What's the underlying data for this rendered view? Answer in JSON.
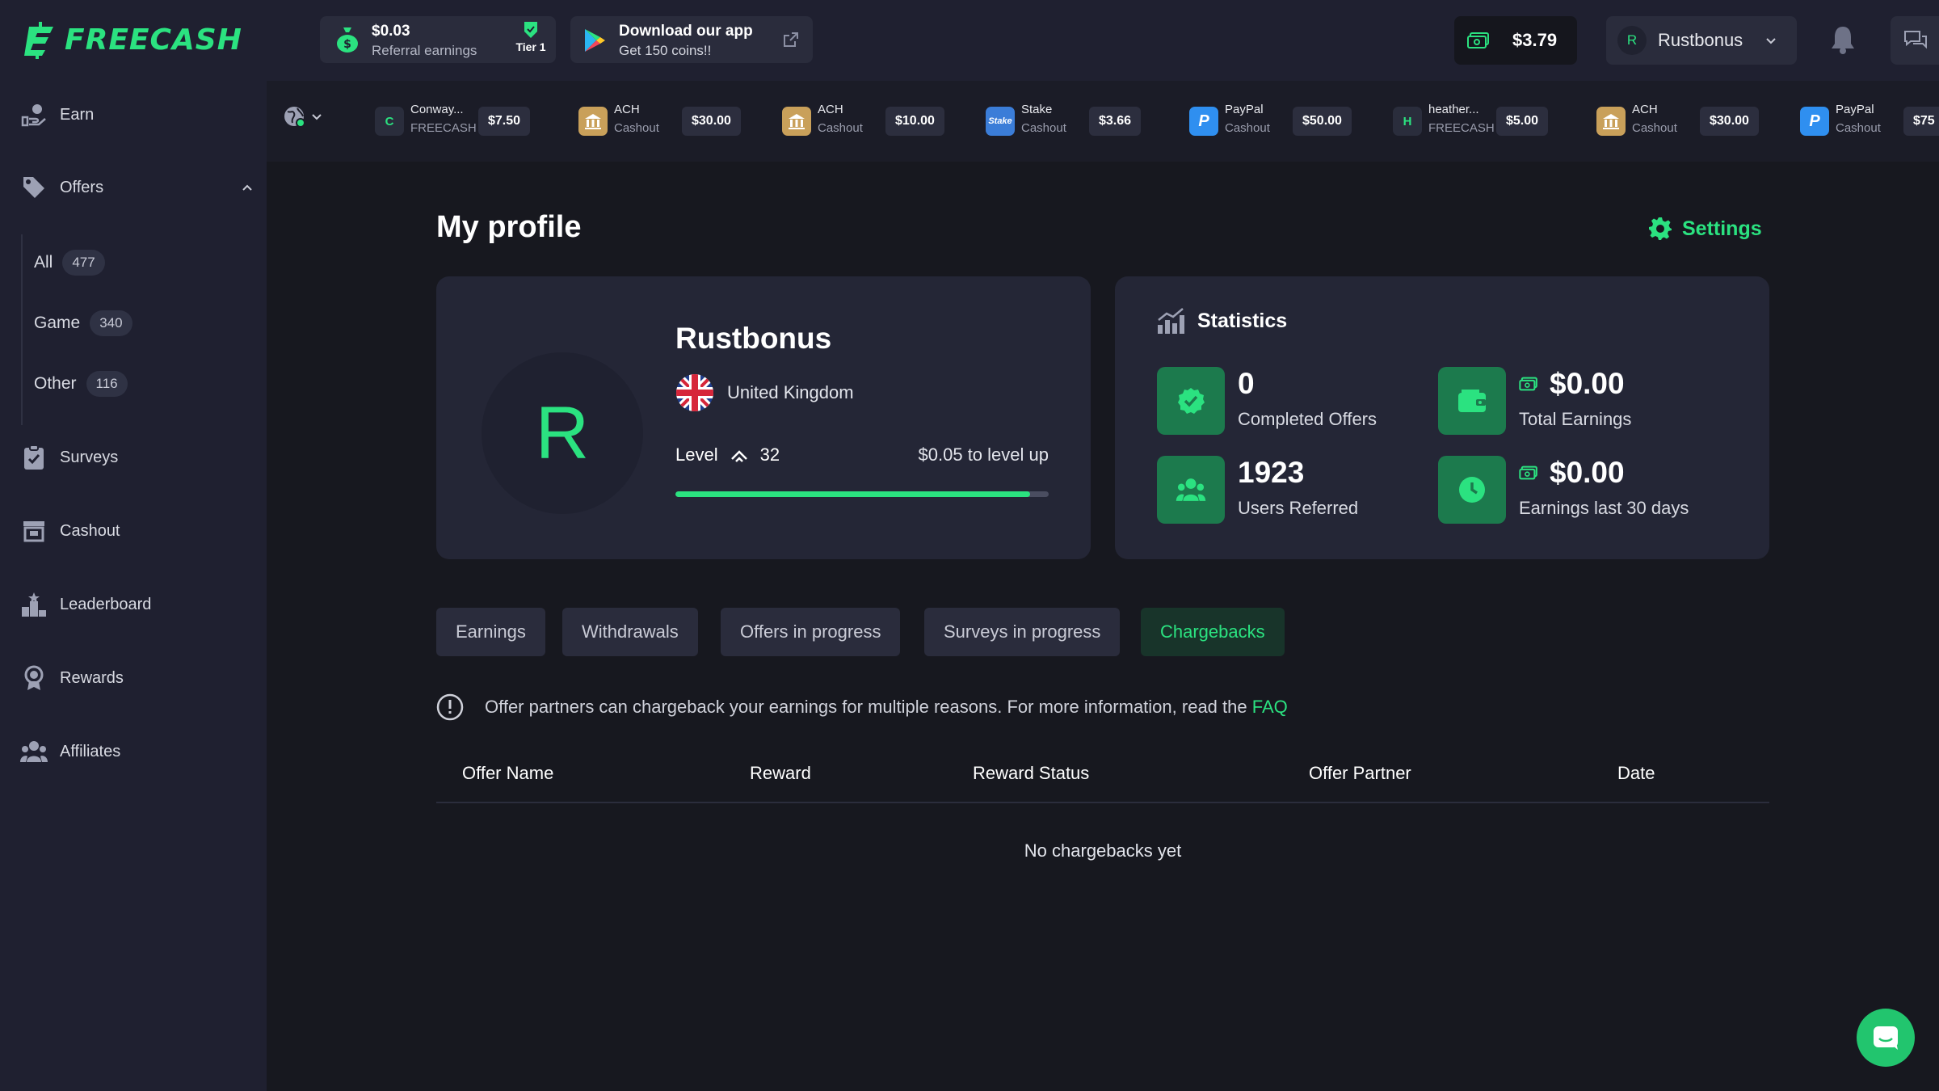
{
  "brand": {
    "logo_text": "FREECASH",
    "accent": "#2be280"
  },
  "header": {
    "referral": {
      "amount": "$0.03",
      "label": "Referral earnings",
      "tier": "Tier 1"
    },
    "app_promo": {
      "title": "Download our app",
      "subtitle": "Get 150 coins!!"
    },
    "balance": "$3.79",
    "user": {
      "initial": "R",
      "name": "Rustbonus"
    }
  },
  "sidebar": {
    "earn": "Earn",
    "offers": "Offers",
    "offer_categories": [
      {
        "label": "All",
        "count": "477"
      },
      {
        "label": "Game",
        "count": "340"
      },
      {
        "label": "Other",
        "count": "116"
      }
    ],
    "surveys": "Surveys",
    "cashout": "Cashout",
    "leaderboard": "Leaderboard",
    "rewards": "Rewards",
    "affiliates": "Affiliates"
  },
  "ticker": [
    {
      "name": "Conway...",
      "sub": "FREECASH",
      "amount": "$7.50",
      "icon": "C"
    },
    {
      "name": "ACH",
      "sub": "Cashout",
      "amount": "$30.00",
      "icon": "bank-icon"
    },
    {
      "name": "ACH",
      "sub": "Cashout",
      "amount": "$10.00",
      "icon": "bank-icon"
    },
    {
      "name": "Stake",
      "sub": "Cashout",
      "amount": "$3.66",
      "icon": "stake-icon"
    },
    {
      "name": "PayPal",
      "sub": "Cashout",
      "amount": "$50.00",
      "icon": "paypal-icon"
    },
    {
      "name": "heather...",
      "sub": "FREECASH",
      "amount": "$5.00",
      "icon": "H"
    },
    {
      "name": "ACH",
      "sub": "Cashout",
      "amount": "$30.00",
      "icon": "bank-icon"
    },
    {
      "name": "PayPal",
      "sub": "Cashout",
      "amount": "$75",
      "icon": "paypal-icon"
    }
  ],
  "main": {
    "title": "My profile",
    "settings": "Settings",
    "profile": {
      "initial": "R",
      "name": "Rustbonus",
      "country": "United Kingdom",
      "level_label": "Level",
      "level": "32",
      "level_up": "$0.05 to level up",
      "progress": 0.95
    },
    "statistics": {
      "title": "Statistics",
      "items": [
        {
          "value": "0",
          "label": "Completed Offers"
        },
        {
          "value": "$0.00",
          "label": "Total Earnings"
        },
        {
          "value": "1923",
          "label": "Users Referred"
        },
        {
          "value": "$0.00",
          "label": "Earnings last 30 days"
        }
      ]
    },
    "tabs": [
      "Earnings",
      "Withdrawals",
      "Offers in progress",
      "Surveys in progress",
      "Chargebacks"
    ],
    "active_tab": "Chargebacks",
    "info_text": "Offer partners can chargeback your earnings for multiple reasons. For more information, read the",
    "info_link": "FAQ",
    "table": {
      "columns": [
        "Offer Name",
        "Reward",
        "Reward Status",
        "Offer Partner",
        "Date"
      ],
      "empty": "No chargebacks yet"
    }
  }
}
